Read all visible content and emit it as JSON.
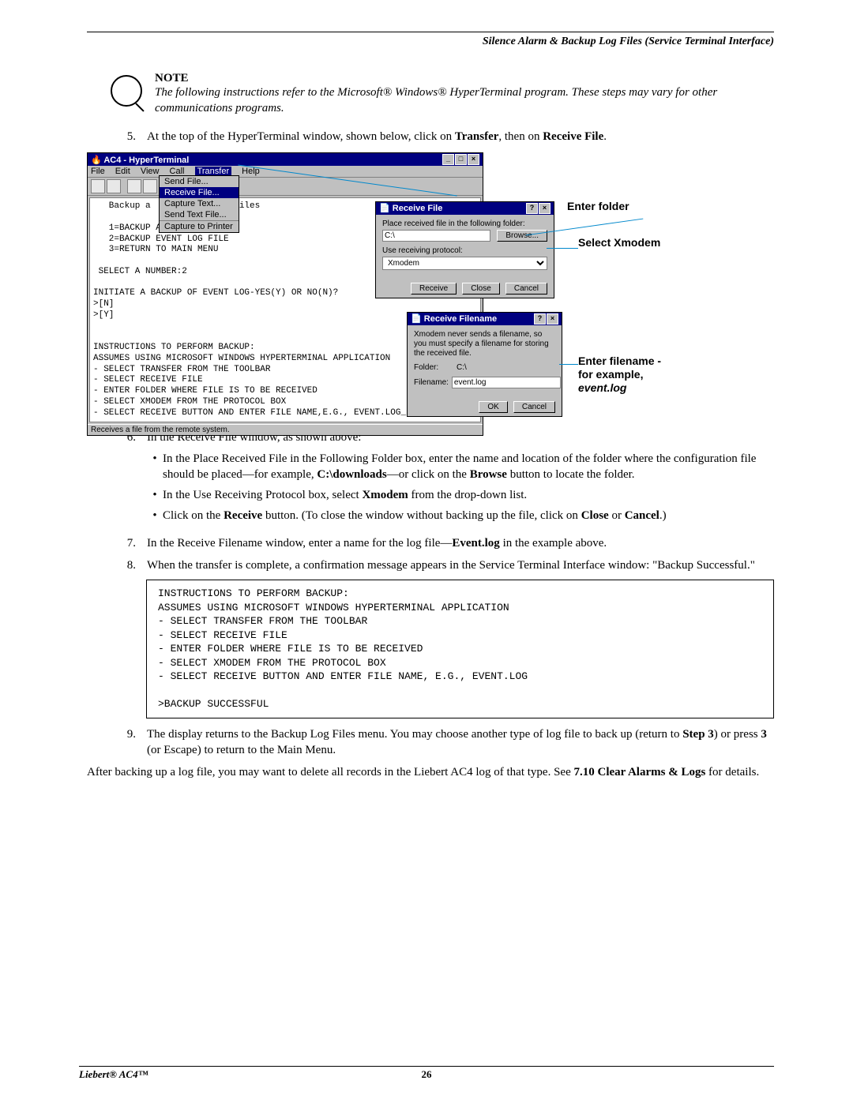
{
  "header": {
    "title": "Silence Alarm & Backup Log Files (Service Terminal Interface)"
  },
  "note": {
    "title": "NOTE",
    "body": "The following instructions refer to the Microsoft® Windows® HyperTerminal program. These steps may vary for other communications programs."
  },
  "step5": {
    "num": "5.",
    "text_a": "At the top of the HyperTerminal window, shown below, click on ",
    "b1": "Transfer",
    "mid": ", then on ",
    "b2": "Receive File",
    "end": "."
  },
  "ht": {
    "title": "AC4 - HyperTerminal",
    "menu": {
      "file": "File",
      "edit": "Edit",
      "view": "View",
      "call": "Call",
      "transfer": "Transfer",
      "help": "Help"
    },
    "dropdown": [
      "Send File...",
      "Receive File...",
      "Capture Text...",
      "Send Text File...",
      "Capture to Printer"
    ],
    "term_lines": "   Backup a            log files\n\n   1=BACKUP ALARM LOG FILE\n   2=BACKUP EVENT LOG FILE\n   3=RETURN TO MAIN MENU\n\n SELECT A NUMBER:2\n\nINITIATE A BACKUP OF EVENT LOG-YES(Y) OR NO(N)?\n>[N]\n>[Y]\n\n\nINSTRUCTIONS TO PERFORM BACKUP:\nASSUMES USING MICROSOFT WINDOWS HYPERTERMINAL APPLICATION\n- SELECT TRANSFER FROM THE TOOLBAR\n- SELECT RECEIVE FILE\n- ENTER FOLDER WHERE FILE IS TO BE RECEIVED\n- SELECT XMODEM FROM THE PROTOCOL BOX\n- SELECT RECEIVE BUTTON AND ENTER FILE NAME,E.G., EVENT.LOG_",
    "status": "Receives a file from the remote system."
  },
  "dlg1": {
    "title": "Receive File",
    "l1": "Place received file in the following folder:",
    "folder": "C:\\",
    "browse": "Browse...",
    "l2": "Use receiving protocol:",
    "proto": "Xmodem",
    "receive": "Receive",
    "close": "Close",
    "cancel": "Cancel"
  },
  "dlg2": {
    "title": "Receive Filename",
    "note": "Xmodem never sends a filename, so you must specify a filename for storing the received file.",
    "folder_l": "Folder:",
    "folder": "C:\\",
    "file_l": "Filename:",
    "file": "event.log",
    "ok": "OK",
    "cancel": "Cancel"
  },
  "callouts": {
    "c1": "Enter folder",
    "c2": "Select Xmodem",
    "c3a": "Enter filename -",
    "c3b": "for example,",
    "c3c": "event.log"
  },
  "step6": {
    "num": "6.",
    "intro": "In the Receive File window, as shown above:",
    "b1a": "In the Place Received File in the Following Folder box, enter the name and location of the folder where the configuration file should be placed—for example, ",
    "b1b": "C:\\downloads",
    "b1c": "—or click on the ",
    "b1d": "Browse",
    "b1e": " button to locate the folder.",
    "b2a": "In the Use Receiving Protocol box, select ",
    "b2b": "Xmodem",
    "b2c": " from the drop-down list.",
    "b3a": "Click on the ",
    "b3b": "Receive",
    "b3c": " button. (To close the window without backing up the file, click on ",
    "b3d": "Close",
    "b3e": " or ",
    "b3f": "Cancel",
    "b3g": ".)"
  },
  "step7": {
    "num": "7.",
    "a": "In the Receive Filename window, enter a name for the log file—",
    "b": "Event.log",
    "c": " in the example above."
  },
  "step8": {
    "num": "8.",
    "text": "When the transfer is complete, a confirmation message appears in the Service Terminal Interface window: \"Backup Successful.\""
  },
  "code": "INSTRUCTIONS TO PERFORM BACKUP:\nASSUMES USING MICROSOFT WINDOWS HYPERTERMINAL APPLICATION\n- SELECT TRANSFER FROM THE TOOLBAR\n- SELECT RECEIVE FILE\n- ENTER FOLDER WHERE FILE IS TO BE RECEIVED\n- SELECT XMODEM FROM THE PROTOCOL BOX\n- SELECT RECEIVE BUTTON AND ENTER FILE NAME, E.G., EVENT.LOG\n\n>BACKUP SUCCESSFUL",
  "step9": {
    "num": "9.",
    "a": "The display returns to the Backup Log Files menu. You may choose another type of log file to back up (return to ",
    "b": "Step 3",
    "c": ") or press ",
    "d": "3",
    "e": " (or Escape) to return to the Main Menu."
  },
  "after": {
    "a": "After backing up a log file, you may want to delete all records in the Liebert AC4 log of that type. See ",
    "b": "7.10 Clear Alarms & Logs",
    "c": " for details."
  },
  "footer": {
    "left": "Liebert® AC4™",
    "page": "26"
  }
}
